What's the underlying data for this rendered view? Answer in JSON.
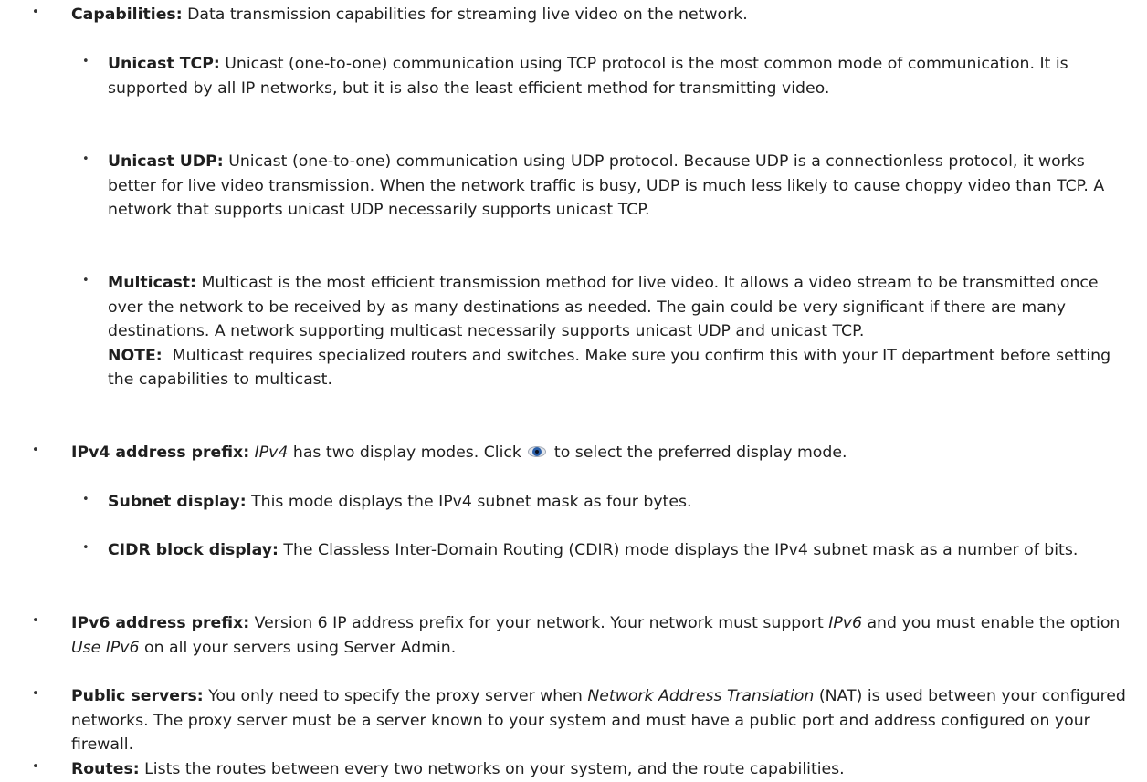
{
  "items": [
    {
      "label": "Capabilities:",
      "text": "Data transmission capabilities for streaming live video on the network."
    },
    {
      "label": "Unicast TCP:",
      "text": "Unicast (one-to-one) communication using TCP protocol is the most common mode of communication. It is supported by all IP networks, but it is also the least efficient method for transmitting video."
    },
    {
      "label": "Unicast UDP:",
      "text": "Unicast (one-to-one) communication using UDP protocol. Because UDP is a connectionless protocol, it works better for live video transmission. When the network traffic is busy, UDP is much less likely to cause choppy video than TCP. A network that supports unicast UDP necessarily supports unicast TCP."
    },
    {
      "label": "Multicast:",
      "text": "Multicast is the most efficient transmission method for live video. It allows a video stream to be transmitted once over the network to be received by as many destinations as needed. The gain could be very significant if there are many destinations. A network supporting multicast necessarily supports unicast UDP and unicast TCP."
    },
    {
      "label": "NOTE:",
      "text": "Multicast requires specialized routers and switches. Make sure you confirm this with your IT department before setting the capabilities to multicast."
    },
    {
      "label": "IPv4 address prefix:",
      "italic": "IPv4",
      "text_a": "has two display modes. Click",
      "icon": "eye-icon",
      "text_b": "to select the preferred display mode."
    },
    {
      "label": "Subnet display:",
      "text": "This mode displays the IPv4 subnet mask as four bytes."
    },
    {
      "label": "CIDR block display:",
      "text": "The Classless Inter-Domain Routing (CDIR) mode displays the IPv4 subnet mask as a number of bits."
    },
    {
      "label": "IPv6 address prefix:",
      "text_a": "Version 6 IP address prefix for your network. Your network must support",
      "italic_a": "IPv6",
      "text_b": "and you must enable the option",
      "italic_b": "Use IPv6",
      "text_c": "on all your servers using Server Admin."
    },
    {
      "label": "Public servers:",
      "text_a": "You only need to specify the proxy server when",
      "italic": "Network Address Translation",
      "text_b": "(NAT) is used between your configured networks. The proxy server must be a server known to your system and must have a public port and address configured on your firewall."
    },
    {
      "label": "Routes:",
      "text": "Lists the routes between every two networks on your system, and the route capabilities."
    }
  ]
}
